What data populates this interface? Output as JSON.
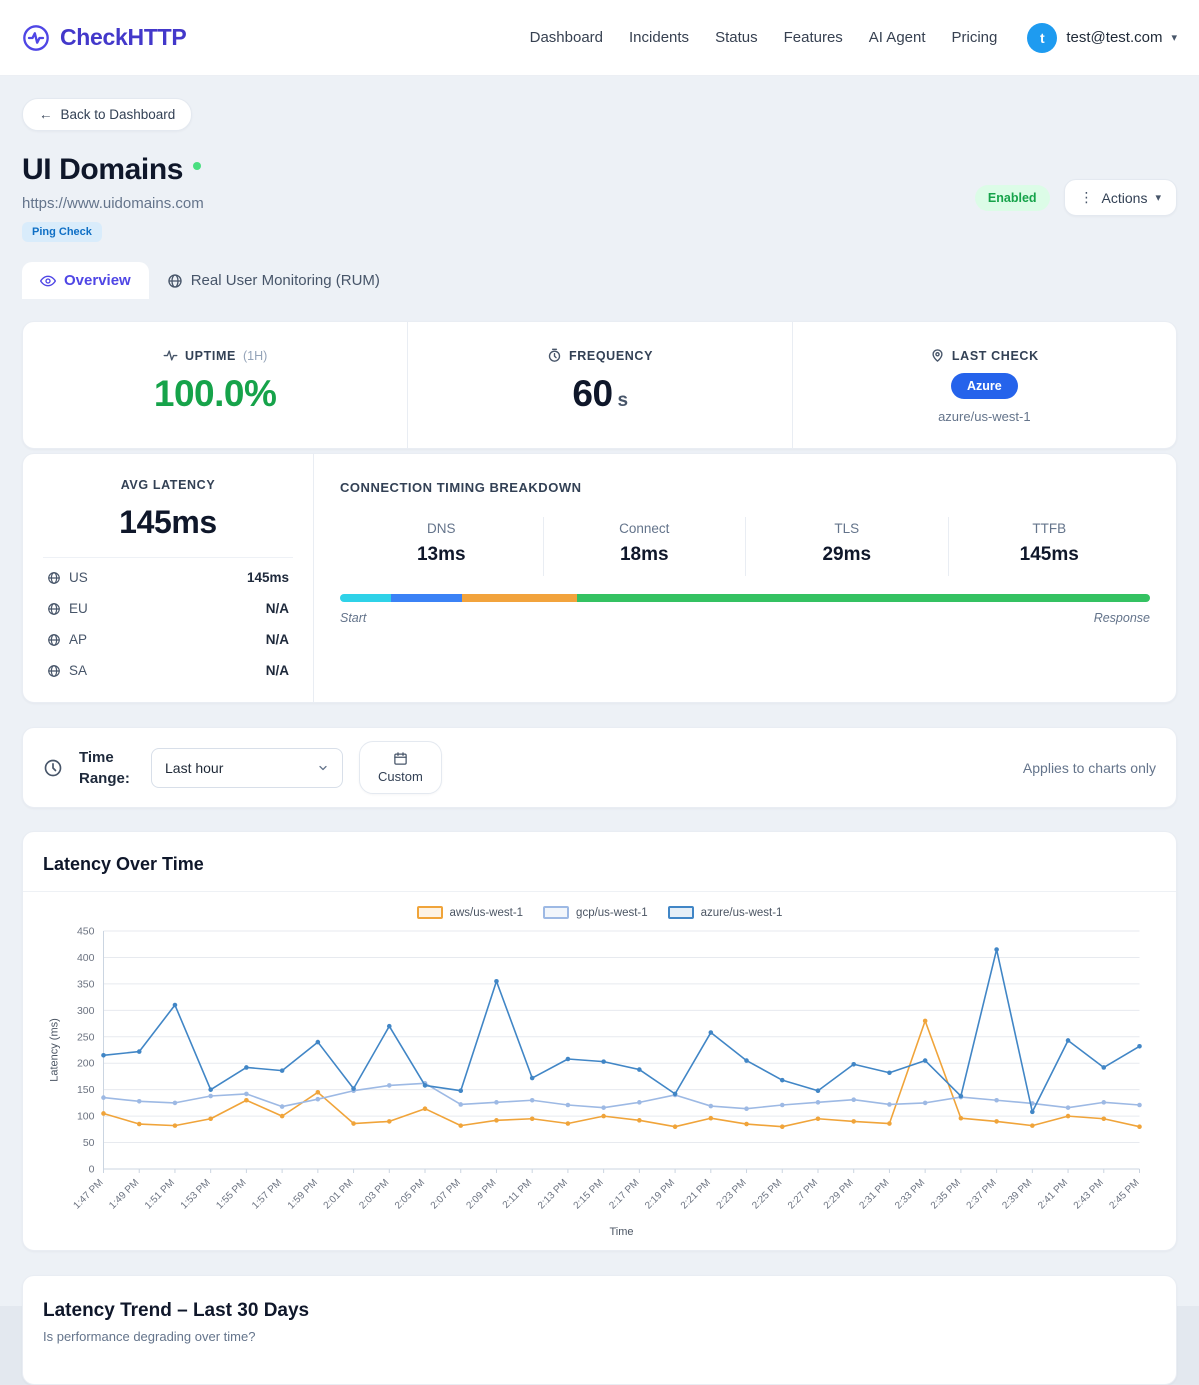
{
  "header": {
    "brand": "CheckHTTP",
    "nav": [
      "Dashboard",
      "Incidents",
      "Status",
      "Features",
      "AI Agent",
      "Pricing"
    ],
    "user": {
      "initial": "t",
      "email": "test@test.com",
      "caret": "▾"
    }
  },
  "page": {
    "back_arrow": "←",
    "back_label": "Back to Dashboard",
    "title": "UI Domains",
    "url": "https://www.uidomains.com",
    "check_type_badge": "Ping Check",
    "status_badge": "Enabled",
    "actions_dots": "⋮",
    "actions_label": "Actions",
    "actions_caret": "▾"
  },
  "tabs": {
    "overview": "Overview",
    "rum": "Real User Monitoring (RUM)"
  },
  "stats": {
    "uptime": {
      "label": "UPTIME",
      "sublabel": "(1H)",
      "value": "100.0%"
    },
    "frequency": {
      "label": "FREQUENCY",
      "value": "60",
      "unit": "s"
    },
    "last_check": {
      "label": "LAST CHECK",
      "provider": "Azure",
      "region": "azure/us-west-1"
    }
  },
  "latency": {
    "label": "AVG LATENCY",
    "value": "145ms",
    "regions": [
      {
        "code": "US",
        "value": "145ms"
      },
      {
        "code": "EU",
        "value": "N/A"
      },
      {
        "code": "AP",
        "value": "N/A"
      },
      {
        "code": "SA",
        "value": "N/A"
      }
    ]
  },
  "timing": {
    "title": "CONNECTION TIMING BREAKDOWN",
    "segments": [
      {
        "label": "DNS",
        "value": "13ms",
        "color": "#2fd2e8",
        "pct": 6.3
      },
      {
        "label": "Connect",
        "value": "18ms",
        "color": "#3b82f6",
        "pct": 8.8
      },
      {
        "label": "TLS",
        "value": "29ms",
        "color": "#f2a33c",
        "pct": 14.1
      },
      {
        "label": "TTFB",
        "value": "145ms",
        "color": "#34c262",
        "pct": 70.8
      }
    ],
    "start_label": "Start",
    "end_label": "Response"
  },
  "time_range": {
    "label": "Time Range:",
    "selected": "Last hour",
    "custom_label": "Custom",
    "note": "Applies to charts only"
  },
  "chart_card": {
    "title": "Latency Over Time"
  },
  "chart_data": {
    "type": "line",
    "title": "Latency Over Time",
    "xlabel": "Time",
    "ylabel": "Latency (ms)",
    "ylim": [
      0,
      450
    ],
    "ytick_step": 50,
    "grid": true,
    "legend_position": "top-center",
    "x": [
      "1:47 PM",
      "1:49 PM",
      "1:51 PM",
      "1:53 PM",
      "1:55 PM",
      "1:57 PM",
      "1:59 PM",
      "2:01 PM",
      "2:03 PM",
      "2:05 PM",
      "2:07 PM",
      "2:09 PM",
      "2:11 PM",
      "2:13 PM",
      "2:15 PM",
      "2:17 PM",
      "2:19 PM",
      "2:21 PM",
      "2:23 PM",
      "2:25 PM",
      "2:27 PM",
      "2:29 PM",
      "2:31 PM",
      "2:33 PM",
      "2:35 PM",
      "2:37 PM",
      "2:39 PM",
      "2:41 PM",
      "2:43 PM",
      "2:45 PM"
    ],
    "series": [
      {
        "name": "aws/us-west-1",
        "color": "#f0a43a",
        "values": [
          105,
          85,
          82,
          95,
          130,
          100,
          145,
          86,
          90,
          114,
          82,
          92,
          95,
          86,
          100,
          92,
          80,
          96,
          85,
          80,
          95,
          90,
          86,
          280,
          96,
          90,
          82,
          100,
          95,
          80
        ]
      },
      {
        "name": "gcp/us-west-1",
        "color": "#9db9e4",
        "values": [
          135,
          128,
          125,
          138,
          142,
          118,
          132,
          148,
          158,
          162,
          122,
          126,
          130,
          121,
          116,
          126,
          140,
          119,
          114,
          121,
          126,
          131,
          122,
          125,
          136,
          130,
          124,
          116,
          126,
          121
        ]
      },
      {
        "name": "azure/us-west-1",
        "color": "#4186c6",
        "values": [
          215,
          222,
          310,
          150,
          192,
          186,
          240,
          152,
          270,
          158,
          148,
          355,
          172,
          208,
          203,
          188,
          142,
          258,
          205,
          168,
          148,
          198,
          182,
          205,
          138,
          415,
          108,
          243,
          192,
          232
        ]
      }
    ]
  },
  "trend_card": {
    "title": "Latency Trend – Last 30 Days",
    "subtitle": "Is performance degrading over time?"
  }
}
